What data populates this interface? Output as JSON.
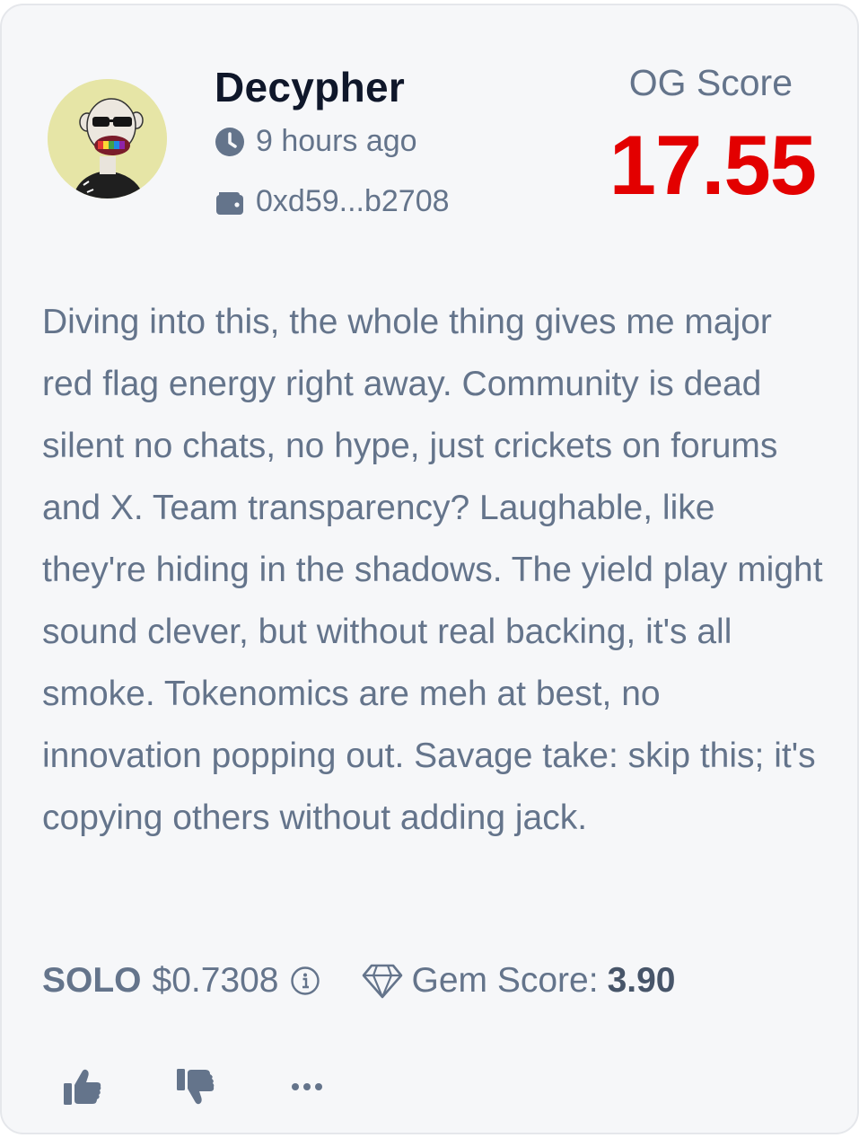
{
  "author": {
    "name": "Decypher",
    "time_ago": "9 hours ago",
    "wallet": "0xd59...b2708",
    "avatar_icon": "ape-avatar-icon"
  },
  "og_score": {
    "label": "OG Score",
    "value": "17.55",
    "color": "#e30000"
  },
  "review": {
    "text": "Diving into this, the whole thing gives me major red flag energy right away. Community is dead silent no chats, no hype, just crickets on forums and X. Team transparency? Laughable, like they're hiding in the shadows. The yield play might sound clever, but without real backing, it's all smoke. Tokenomics are meh at best, no innovation popping out. Savage take: skip this; it's copying others without adding jack."
  },
  "token": {
    "symbol": "SOLO",
    "price": "$0.7308",
    "info_icon": "info-icon"
  },
  "gem": {
    "label": "Gem Score:",
    "value": "3.90",
    "icon": "diamond-icon"
  },
  "actions": {
    "like_icon": "thumbs-up-icon",
    "dislike_icon": "thumbs-down-icon",
    "more_icon": "more-icon"
  }
}
